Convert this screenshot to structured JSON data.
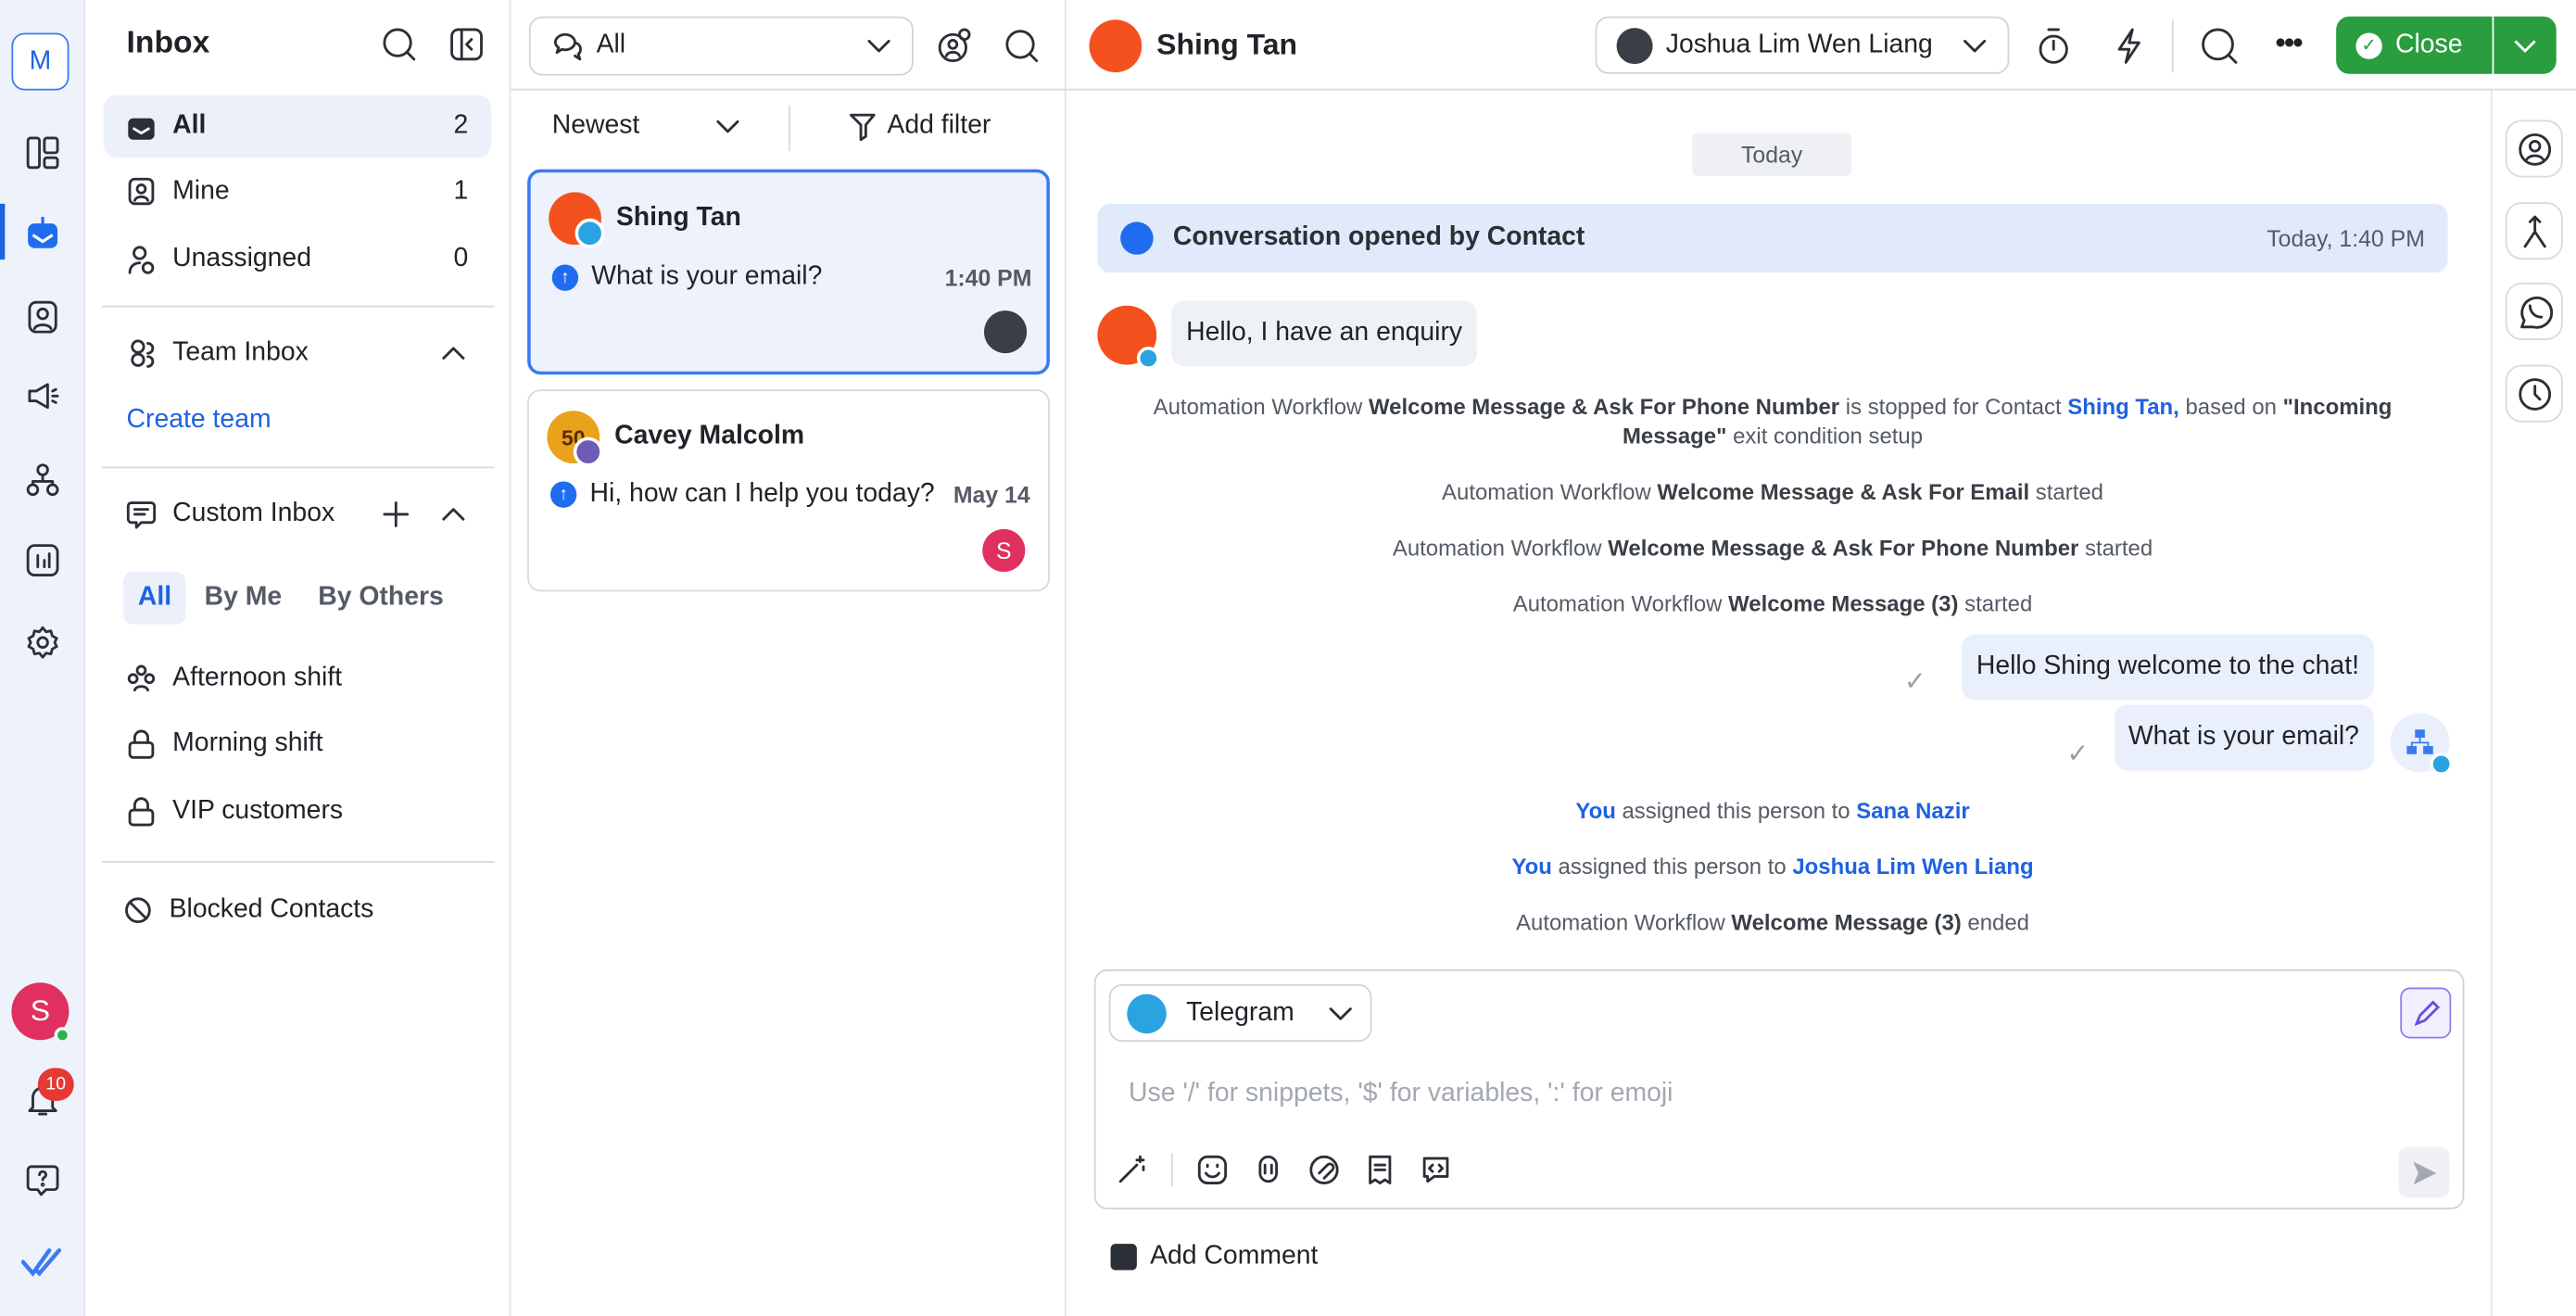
{
  "rail": {
    "workspace_initial": "M",
    "user_initial": "S",
    "notification_count": "10"
  },
  "sidebar": {
    "title": "Inbox",
    "items": [
      {
        "label": "All",
        "count": "2"
      },
      {
        "label": "Mine",
        "count": "1"
      },
      {
        "label": "Unassigned",
        "count": "0"
      }
    ],
    "team_inbox": "Team Inbox",
    "create_team": "Create team",
    "custom_inbox": "Custom Inbox",
    "filters": [
      "All",
      "By Me",
      "By Others"
    ],
    "custom_items": [
      "Afternoon shift",
      "Morning shift",
      "VIP customers"
    ],
    "blocked": "Blocked Contacts"
  },
  "list": {
    "filter_value": "All",
    "sort": "Newest",
    "add_filter": "Add filter",
    "conversations": [
      {
        "name": "Shing Tan",
        "preview": "What is your email?",
        "time": "1:40 PM"
      },
      {
        "name": "Cavey Malcolm",
        "preview": "Hi, how can I help you today?",
        "time": "May 14",
        "assignee_initial": "S",
        "avatar_text": "50"
      }
    ]
  },
  "chat": {
    "contact_name": "Shing Tan",
    "assignee": "Joshua Lim Wen Liang",
    "close_label": "Close",
    "date_sep": "Today",
    "opened": {
      "text_prefix": "Conversation opened by ",
      "text_bold": "Contact",
      "time": "Today, 1:40 PM"
    },
    "msg_in": "Hello, I have an enquiry",
    "sys1": {
      "a": "Automation Workflow ",
      "b": "Welcome Message & Ask For Phone Number",
      "c": " is stopped for Contact ",
      "d": "Shing Tan,",
      "e": " based on ",
      "f": "\"Incoming Message\"",
      "g": " exit condition setup"
    },
    "sys2": {
      "a": "Automation Workflow ",
      "b": "Welcome Message & Ask For Email",
      "c": " started"
    },
    "sys3": {
      "a": "Automation Workflow ",
      "b": "Welcome Message & Ask For Phone Number",
      "c": " started"
    },
    "sys4": {
      "a": "Automation Workflow ",
      "b": "Welcome Message (3)",
      "c": " started"
    },
    "msg_out1": "Hello Shing welcome to the chat!",
    "msg_out2": "What is your email?",
    "assign1": {
      "you": "You",
      "mid": " assigned this person to ",
      "who": "Sana Nazir"
    },
    "assign2": {
      "you": "You",
      "mid": " assigned this person to ",
      "who": "Joshua Lim Wen Liang"
    },
    "sys5": {
      "a": "Automation Workflow ",
      "b": "Welcome Message (3)",
      "c": " ended"
    },
    "composer": {
      "channel": "Telegram",
      "placeholder": "Use '/' for snippets, '$' for variables, ':' for emoji",
      "add_comment": "Add Comment"
    }
  },
  "colors": {
    "accent": "#1f62e0",
    "close_green": "#2a9d3f",
    "telegram": "#2aa3e0"
  }
}
